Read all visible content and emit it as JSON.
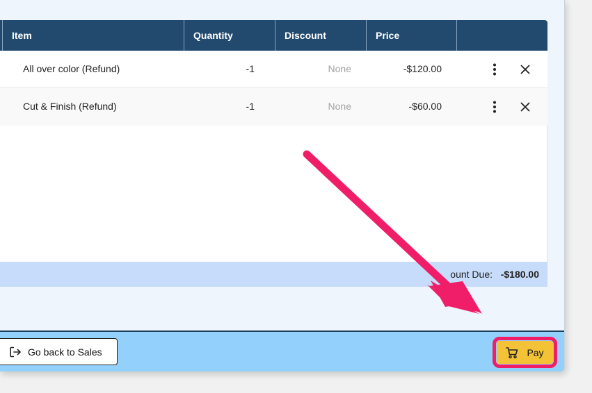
{
  "table": {
    "columns": [
      "Item",
      "Quantity",
      "Discount",
      "Price"
    ],
    "rows": [
      {
        "item": "All over color (Refund)",
        "quantity": "-1",
        "discount": "None",
        "price": "-$120.00"
      },
      {
        "item": "Cut & Finish (Refund)",
        "quantity": "-1",
        "discount": "None",
        "price": "-$60.00"
      }
    ]
  },
  "total": {
    "label": "ount Due:",
    "value": "-$180.00"
  },
  "footer": {
    "back_label": "Go back to Sales",
    "pay_label": "Pay"
  },
  "icons": {
    "back": "logout-icon",
    "pay": "cart-icon",
    "row_menu": "more-vertical-icon",
    "row_remove": "close-icon"
  },
  "colors": {
    "header": "#214a6e",
    "total_bar": "#c7dcfa",
    "footer": "#93d0fb",
    "pay_button": "#f3c237",
    "highlight": "#f01e68"
  }
}
